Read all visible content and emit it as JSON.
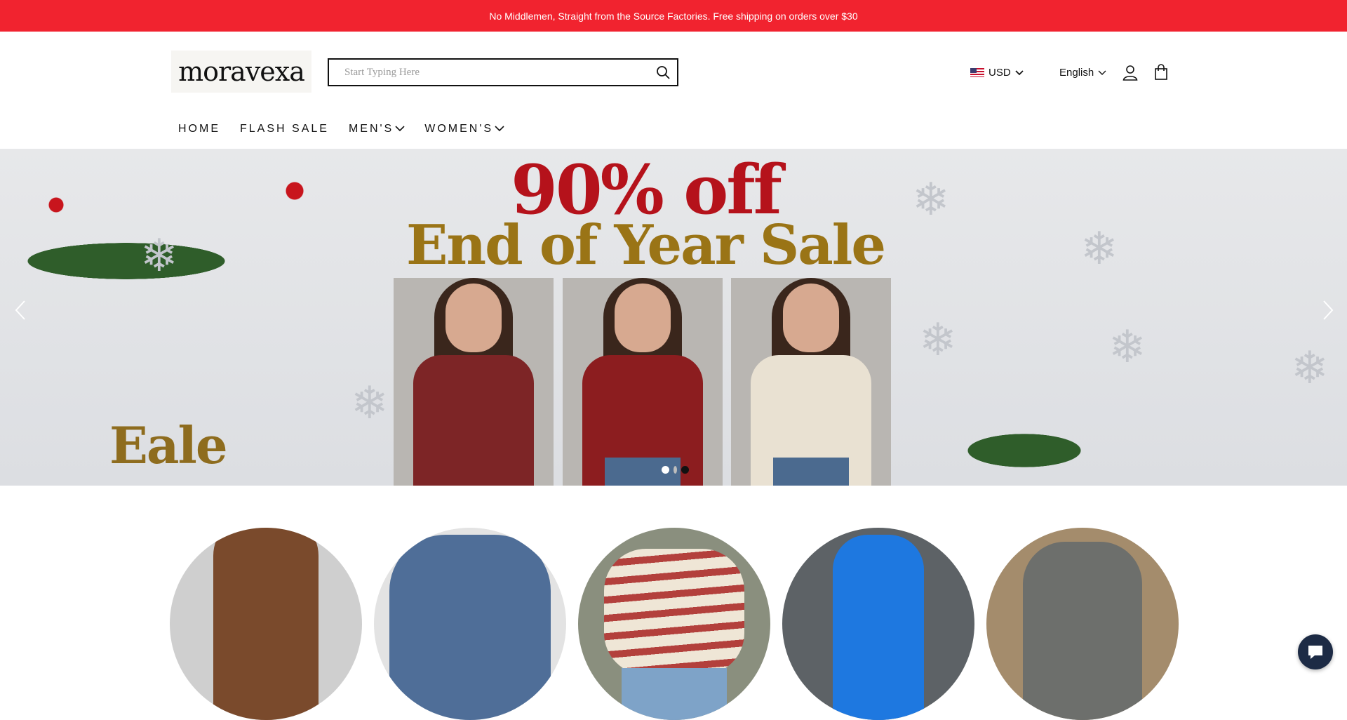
{
  "announcement": "No Middlemen, Straight from the Source Factories. Free shipping on orders over $30",
  "brand": {
    "logo_text": "moravexa"
  },
  "search": {
    "placeholder": "Start Typing Here",
    "value": "",
    "icon": "search-icon"
  },
  "header": {
    "currency": "USD",
    "language": "English",
    "account_icon": "user-icon",
    "cart_icon": "shopping-bag-icon"
  },
  "nav": {
    "items": [
      {
        "label": "HOME",
        "dropdown": false
      },
      {
        "label": "FLASH SALE",
        "dropdown": false
      },
      {
        "label": "MEN'S",
        "dropdown": true
      },
      {
        "label": "WOMEN'S",
        "dropdown": true
      }
    ]
  },
  "hero": {
    "headline": "90% off",
    "subheadline": "End of Year Sale",
    "partial_text": "Eale",
    "slides_total": 3,
    "active_slide": 1,
    "colors": {
      "headline": "#b5121b",
      "subheadline": "#9a7416"
    }
  },
  "categories": [
    {
      "name": "brown-tank-top"
    },
    {
      "name": "blue-knit-sweater"
    },
    {
      "name": "striped-off-shoulder-sweater"
    },
    {
      "name": "blue-long-coat"
    },
    {
      "name": "grey-lounge-set"
    }
  ],
  "chat": {
    "icon": "chat-bubble-icon"
  },
  "colors": {
    "announcement_bg": "#f1232f",
    "chat_bg": "#1d2b45"
  }
}
